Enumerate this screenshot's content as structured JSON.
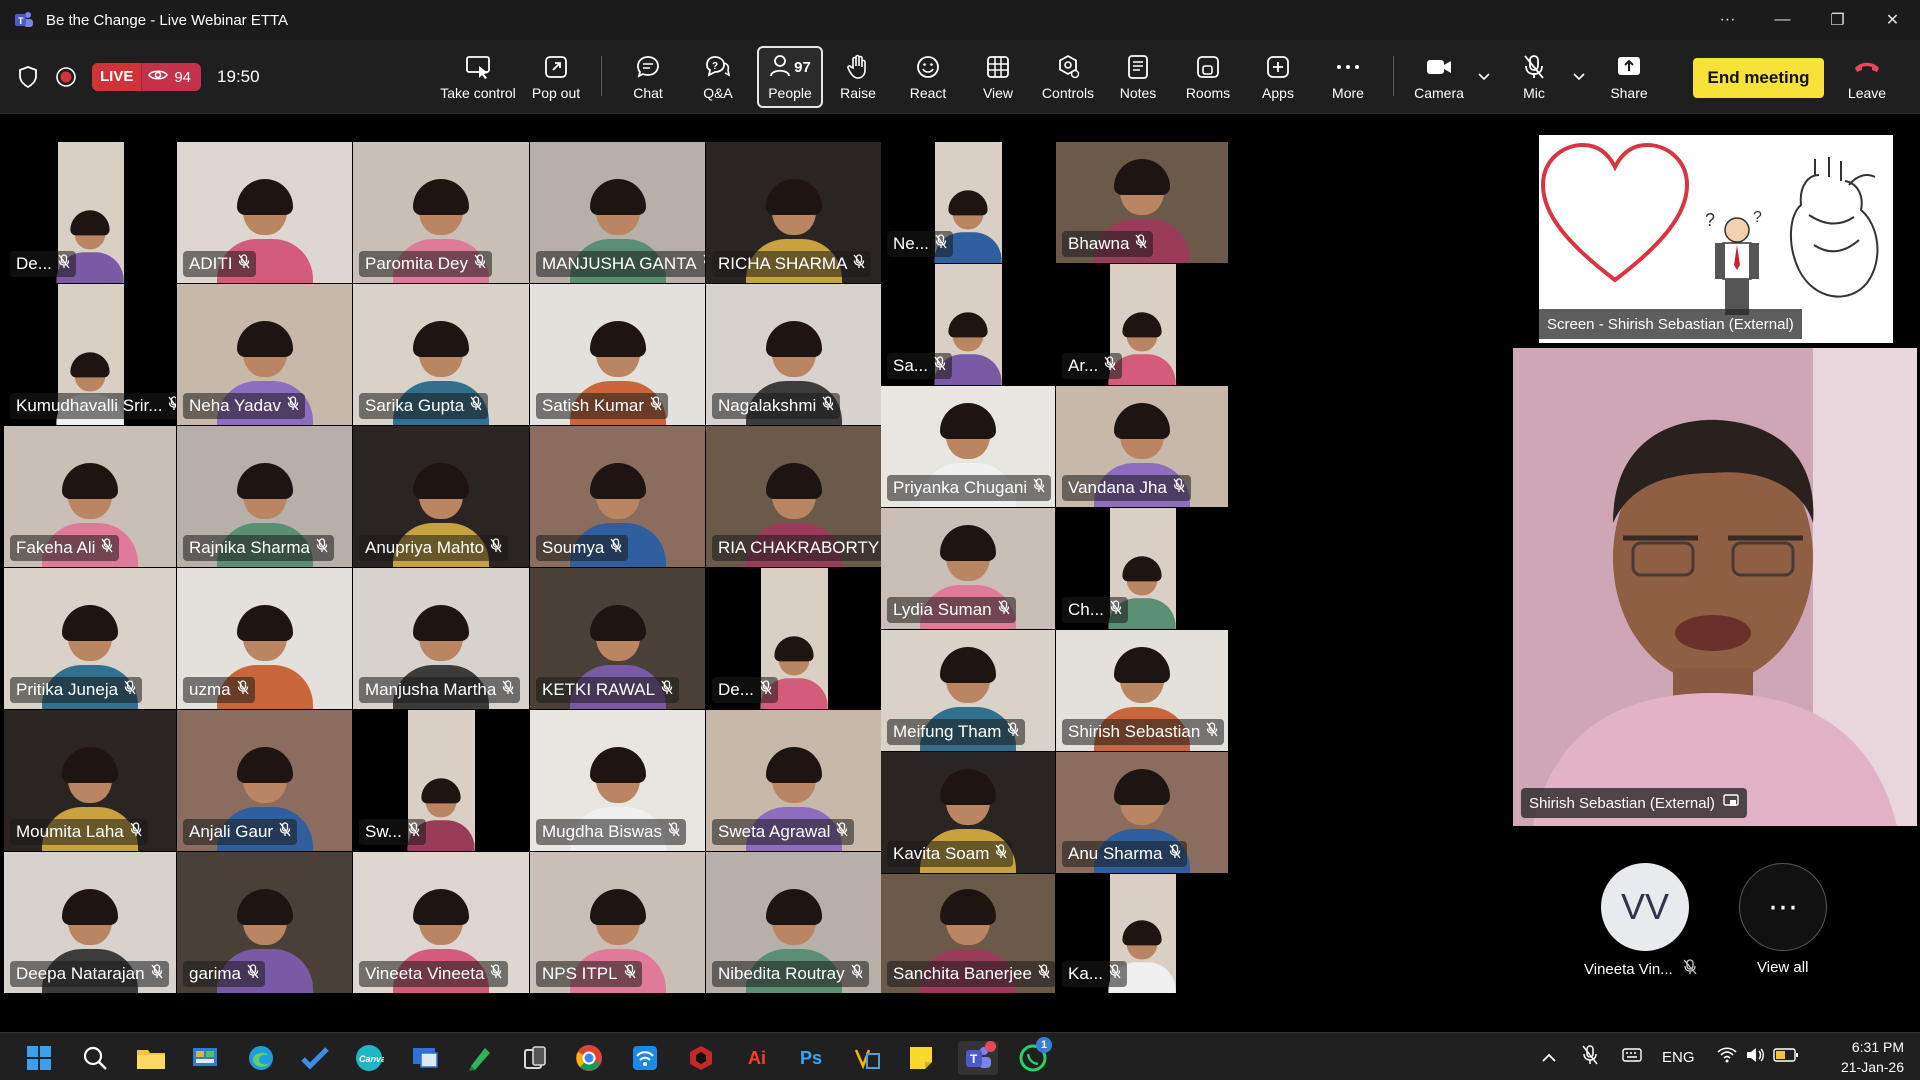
{
  "window": {
    "title": "Be the Change - Live Webinar ETTA",
    "controls": [
      "···",
      "—",
      "❐",
      "✕"
    ]
  },
  "status": {
    "live_label": "LIVE",
    "viewer_count": "94",
    "timer": "19:50"
  },
  "toolbar": {
    "take_control": "Take control",
    "pop_out": "Pop out",
    "chat": "Chat",
    "qa": "Q&A",
    "people": "People",
    "people_count": "97",
    "raise": "Raise",
    "react": "React",
    "view": "View",
    "controls": "Controls",
    "notes": "Notes",
    "rooms": "Rooms",
    "apps": "Apps",
    "more": "More",
    "camera": "Camera",
    "mic": "Mic",
    "share": "Share",
    "end_meeting": "End meeting",
    "leave": "Leave"
  },
  "participants": [
    "De...",
    "ADITI",
    "Paromita Dey",
    "MANJUSHA GANTA",
    "RICHA SHARMA",
    "Ne...",
    "Bhawna",
    "Kumudhavalli Srir...",
    "Neha Yadav",
    "Sarika Gupta",
    "Satish Kumar",
    "Nagalakshmi",
    "Sa...",
    "Ar...",
    "Fakeha Ali",
    "Rajnika Sharma",
    "Anupriya Mahto",
    "Soumya",
    "RIA CHAKRABORTY",
    "Priyanka Chugani",
    "Vandana Jha",
    "Pritika Juneja",
    "uzma",
    "Manjusha Martha",
    "KETKI RAWAL",
    "De...",
    "Lydia Suman",
    "Ch...",
    "Moumita Laha",
    "Anjali Gaur",
    "Sw...",
    "Mugdha Biswas",
    "Sweta Agrawal",
    "Meifung Tham",
    "Shirish Sebastian",
    "Deepa Natarajan",
    "garima",
    "Vineeta Vineeta",
    "NPS ITPL",
    "Nibedita Routray",
    "Kavita Soam",
    "Anu Sharma",
    "Sanchita Banerjee",
    "Ka..."
  ],
  "share_screen": {
    "caption": "Screen - Shirish Sebastian (External)"
  },
  "speaker": {
    "caption": "Shirish Sebastian (External)"
  },
  "extra": {
    "avatar_initials": "VV",
    "avatar_name": "Vineeta Vin...",
    "view_all": "View all"
  },
  "taskbar": {
    "lang": "ENG",
    "time": "6:31 PM",
    "date": "21-Jan-26",
    "teams_badge": "1"
  },
  "colors": {
    "live_red": "#d13438",
    "end_yellow": "#f7e23a",
    "leave_red": "#e5485a",
    "toolbar_bg": "#1f1f1f"
  }
}
